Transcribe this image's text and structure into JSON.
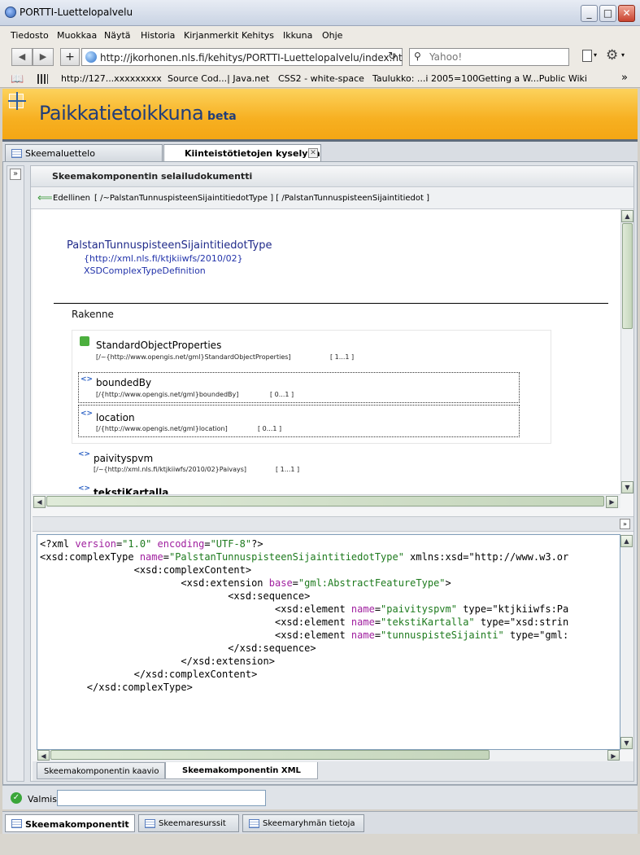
{
  "window": {
    "title": "PORTTI-Luettelopalvelu",
    "controls": {
      "minimize": "_",
      "maximize": "□",
      "close": "✕"
    }
  },
  "menubar": [
    "Tiedosto",
    "Muokkaa",
    "Näytä",
    "Historia",
    "Kirjanmerkit",
    "Kehitys",
    "Ikkuna",
    "Ohje"
  ],
  "navbar": {
    "back": "◀",
    "forward": "▶",
    "newtab": "+",
    "url": "http://jkorhonen.nls.fi/kehitys/PORTTI-Luettelopalvelu/index.ht",
    "reload": "↻",
    "search_placeholder": "Yahoo!",
    "search_icon": "search-icon",
    "page_icon": "page-icon",
    "gear_icon": "gear-icon"
  },
  "bookmarks": [
    "http://127...xxxxxxxxx",
    "Source Cod...| Java.net",
    "CSS2 - white-space",
    "Taulukko: ...i 2005=100",
    "Getting a W...Public Wiki"
  ],
  "app": {
    "title": "Paikkatietoikkuna",
    "badge": "beta",
    "accent": "#f7b021",
    "brand_color": "#213e7a"
  },
  "main_tabs": [
    {
      "label": "Skeemaluettelo",
      "active": false
    },
    {
      "label": "Kiinteistötietojen kyselypa",
      "active": true
    }
  ],
  "panel": {
    "title": "Skeemakomponentin selailudokumentti",
    "nav": {
      "prev_label": "Edellinen",
      "breadcrumbs": "[ /~PalstanTunnuspisteenSijaintitiedotType ] [ /PalstanTunnuspisteenSijaintitiedot ]"
    }
  },
  "document": {
    "type_name": "PalstanTunnuspisteenSijaintitiedotType",
    "namespace": "{http://xml.nls.fi/ktjkiiwfs/2010/02}",
    "definition": "XSDComplexTypeDefinition",
    "section": "Rakenne",
    "components": [
      {
        "name": "StandardObjectProperties",
        "ref": "[/~{http://www.opengis.net/gml}StandardObjectProperties]",
        "occurs": "[ 1...1 ]",
        "icon": "puzzle-icon"
      },
      {
        "name": "boundedBy",
        "ref": "[/{http://www.opengis.net/gml}boundedBy]",
        "occurs": "[ 0...1 ]",
        "icon": "element-icon"
      },
      {
        "name": "location",
        "ref": "[/{http://www.opengis.net/gml}location]",
        "occurs": "[ 0...1 ]",
        "icon": "element-icon"
      },
      {
        "name": "paivityspvm",
        "ref": "[/~{http://xml.nls.fi/ktjkiiwfs/2010/02}Paivays]",
        "occurs": "[ 1...1 ]",
        "icon": "element-icon"
      },
      {
        "name": "tekstiKartalla",
        "ref": "",
        "occurs": "",
        "icon": "element-icon"
      }
    ]
  },
  "xml_lines": [
    "<?xml version=\"1.0\" encoding=\"UTF-8\"?>",
    "<xsd:complexType name=\"PalstanTunnuspisteenSijaintitiedotType\" xmlns:xsd=\"http://www.w3.or",
    "                <xsd:complexContent>",
    "                        <xsd:extension base=\"gml:AbstractFeatureType\">",
    "                                <xsd:sequence>",
    "                                        <xsd:element name=\"paivityspvm\" type=\"ktjkiiwfs:Pa",
    "                                        <xsd:element name=\"tekstiKartalla\" type=\"xsd:strin",
    "                                        <xsd:element name=\"tunnuspisteSijainti\" type=\"gml:",
    "                                </xsd:sequence>",
    "                        </xsd:extension>",
    "                </xsd:complexContent>",
    "        </xsd:complexType>"
  ],
  "sub_tabs": [
    {
      "label": "Skeemakomponentin kaavio",
      "active": false
    },
    {
      "label": "Skeemakomponentin XML",
      "active": true
    }
  ],
  "status": {
    "text": "Valmis",
    "field_value": ""
  },
  "bottom_tabs": [
    {
      "label": "Skeemakomponentit",
      "active": true
    },
    {
      "label": "Skeemaresurssit",
      "active": false
    },
    {
      "label": "Skeemaryhmän tietoja",
      "active": false
    }
  ]
}
